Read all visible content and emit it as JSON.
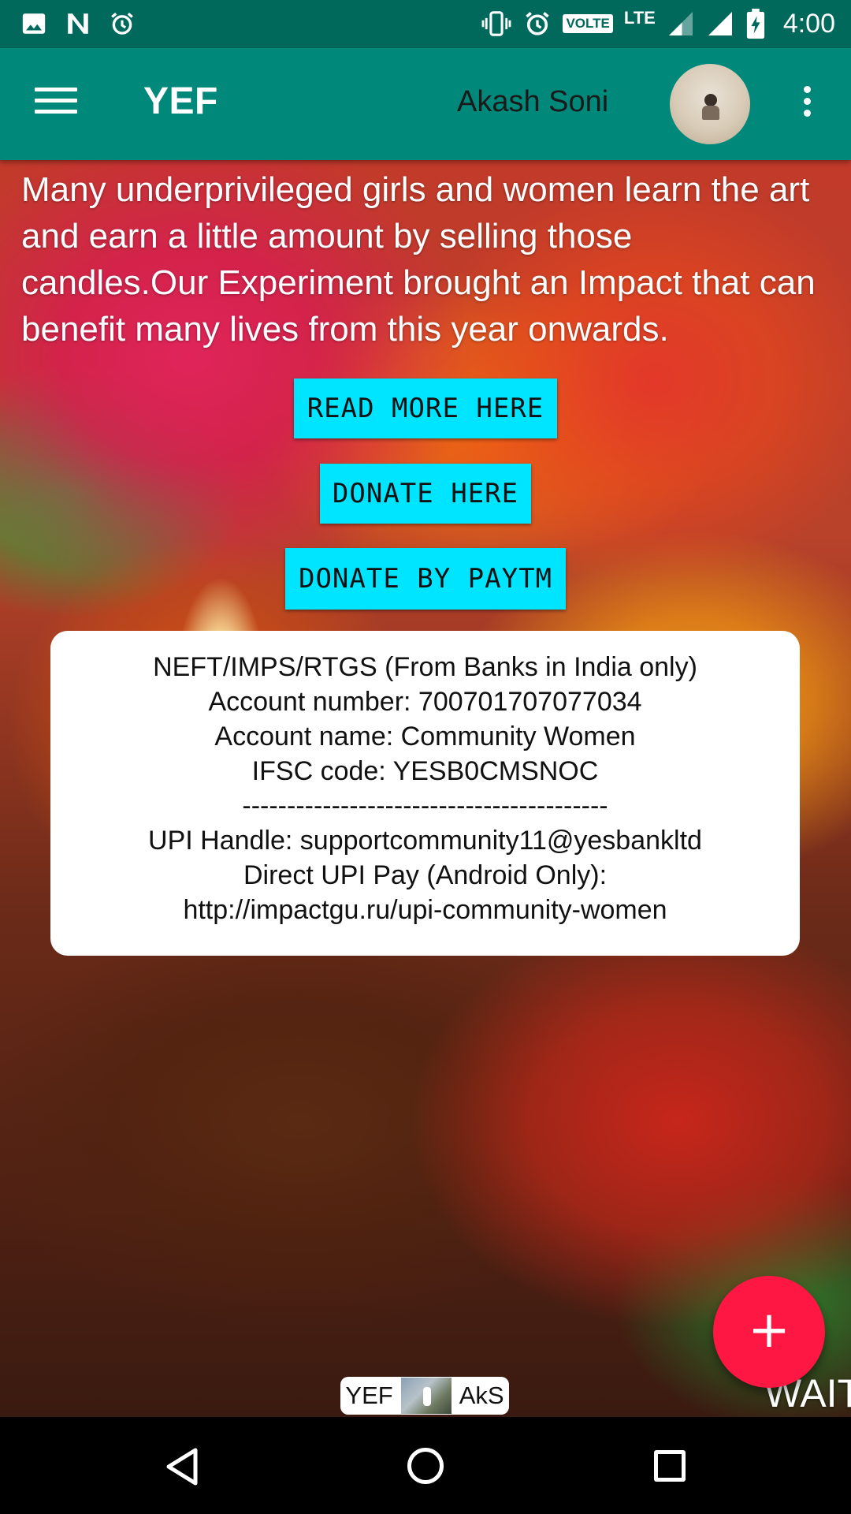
{
  "status_bar": {
    "time": "4:00",
    "network": "LTE",
    "volte": "VOLTE",
    "icons": [
      "image-icon",
      "n-notification-icon",
      "alarm-icon",
      "vibrate-icon",
      "alarm-icon",
      "signal-icon",
      "signal-icon",
      "battery-charging-icon"
    ]
  },
  "app_bar": {
    "title": "YEF",
    "user_name": "Akash Soni",
    "menu_icon": "hamburger-menu-icon",
    "overflow_icon": "more-vert-icon"
  },
  "content": {
    "story_text": "Many underprivileged girls and women learn the art and earn a little amount by selling those candles.Our Experiment brought an Impact that can benefit many lives from this year onwards.",
    "buttons": {
      "read_more": "READ MORE HERE",
      "donate": "DONATE HERE",
      "donate_paytm": "DONATE BY PAYTM"
    },
    "bank_details": {
      "line1": "NEFT/IMPS/RTGS (From Banks in India only)",
      "line2": "Account number: 700701707077034",
      "line3": "Account name: Community Women",
      "line4": "IFSC code: YESB0CMSNOC",
      "separator": "-----------------------------------------",
      "line5": "UPI Handle: supportcommunity11@yesbankltd",
      "line6": "Direct UPI Pay (Android Only):",
      "line7": "http://impactgu.ru/upi-community-women"
    },
    "fab_label": "+",
    "wait_text": "WAIT",
    "footer_badge": {
      "left_text": "YEF",
      "right_text": "AkS"
    }
  },
  "colors": {
    "status_bar": "#00695c",
    "app_bar": "#00897b",
    "button_cyan": "#00e5ff",
    "fab": "#ff1744"
  },
  "nav_bar": {
    "icons": [
      "back-icon",
      "home-icon",
      "recents-icon"
    ]
  }
}
